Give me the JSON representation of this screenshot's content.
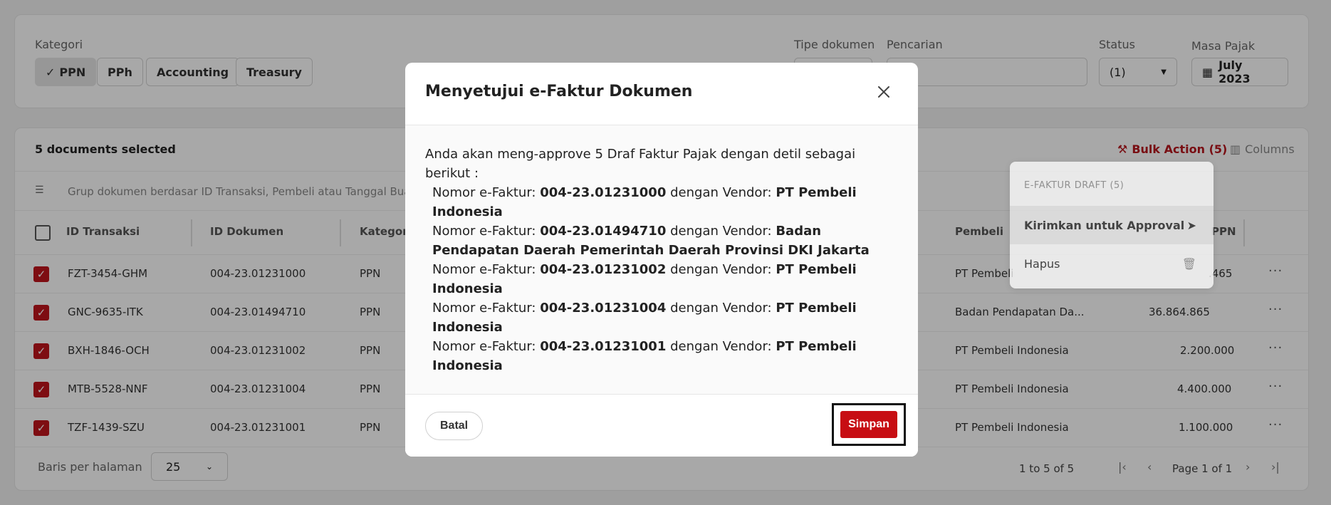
{
  "filters": {
    "kategori_label": "Kategori",
    "chips": [
      {
        "label": "PPN",
        "active": true
      },
      {
        "label": "PPh",
        "active": false
      },
      {
        "label": "Accounting",
        "active": false
      },
      {
        "label": "Treasury",
        "active": false
      }
    ],
    "tipe_label": "Tipe dokumen",
    "pencarian_label": "Pencarian",
    "status_label": "Status",
    "status_value": "(1)",
    "masa_label": "Masa Pajak",
    "masa_value": "July 2023"
  },
  "table": {
    "selected_text": "5 documents selected",
    "bulk_action": "Bulk Action (5)",
    "columns_label": "Columns",
    "group_placeholder": "Grup dokumen berdasar ID Transaksi, Pembeli atau Tanggal Buat",
    "headers": {
      "id_transaksi": "ID Transaksi",
      "id_dokumen": "ID Dokumen",
      "kategori": "Kategori",
      "pembeli": "Pembeli",
      "ppn": "PPN"
    },
    "rows": [
      {
        "id_transaksi": "FZT-3454-GHM",
        "id_dokumen": "004-23.01231000",
        "kategori": "PPN",
        "pembeli": "PT Pembeli",
        "ppn": ".465"
      },
      {
        "id_transaksi": "GNC-9635-ITK",
        "id_dokumen": "004-23.01494710",
        "kategori": "PPN",
        "pembeli": "Badan Pendapatan Da...",
        "ppn": "36.864.865"
      },
      {
        "id_transaksi": "BXH-1846-OCH",
        "id_dokumen": "004-23.01231002",
        "kategori": "PPN",
        "pembeli": "PT Pembeli Indonesia",
        "ppn": "2.200.000"
      },
      {
        "id_transaksi": "MTB-5528-NNF",
        "id_dokumen": "004-23.01231004",
        "kategori": "PPN",
        "pembeli": "PT Pembeli Indonesia",
        "ppn": "4.400.000"
      },
      {
        "id_transaksi": "TZF-1439-SZU",
        "id_dokumen": "004-23.01231001",
        "kategori": "PPN",
        "pembeli": "PT Pembeli Indonesia",
        "ppn": "1.100.000"
      }
    ],
    "rows_per_page_label": "Baris per halaman",
    "rows_per_page_value": "25",
    "page_info": "1 to 5 of 5",
    "page_label": "Page 1 of 1"
  },
  "dropdown": {
    "header": "E-FAKTUR DRAFT (5)",
    "items": [
      {
        "label": "Kirimkan untuk Approval",
        "icon": "send-icon"
      },
      {
        "label": "Hapus",
        "icon": "trash-icon"
      }
    ]
  },
  "modal": {
    "title": "Menyetujui e-Faktur Dokumen",
    "intro": "Anda akan meng-approve 5 Draf Faktur Pajak dengan detil sebagai berikut :",
    "entry_prefix": "Nomor e-Faktur:",
    "entry_mid": "dengan Vendor:",
    "entries": [
      {
        "nomor": "004-23.01231000",
        "vendor": "PT Pembeli Indonesia"
      },
      {
        "nomor": "004-23.01494710",
        "vendor": "Badan Pendapatan Daerah Pemerintah Daerah Provinsi DKI Jakarta"
      },
      {
        "nomor": "004-23.01231002",
        "vendor": "PT Pembeli Indonesia"
      },
      {
        "nomor": "004-23.01231004",
        "vendor": "PT Pembeli Indonesia"
      },
      {
        "nomor": "004-23.01231001",
        "vendor": "PT Pembeli Indonesia"
      }
    ],
    "cancel_label": "Batal",
    "save_label": "Simpan"
  },
  "colors": {
    "accent": "#c70d13",
    "overlay": "rgba(0,0,0,0.34)"
  }
}
